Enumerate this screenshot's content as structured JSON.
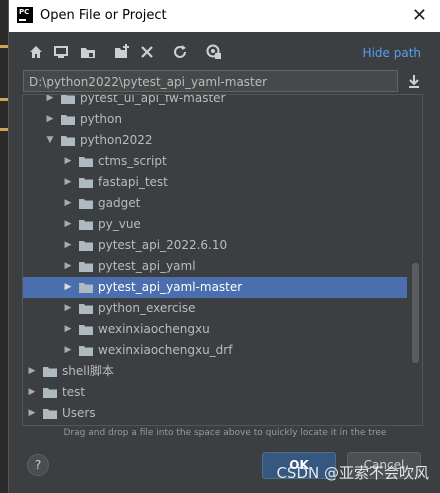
{
  "window": {
    "title": "Open File or Project",
    "close_glyph": "✕"
  },
  "toolbar": {
    "buttons": [
      "home-icon",
      "desktop-icon",
      "project-icon",
      "new-folder-icon",
      "delete-icon",
      "refresh-icon",
      "show-hidden-icon"
    ],
    "hide_path_label": "Hide path"
  },
  "path": {
    "value": "D:\\python2022\\pytest_api_yaml-master"
  },
  "tree": {
    "rows": [
      {
        "label": "pytest_ui_api_fw-master",
        "expanded": false
      },
      {
        "label": "python",
        "expanded": false
      },
      {
        "label": "python2022",
        "expanded": true
      },
      {
        "label": "ctms_script",
        "expanded": false
      },
      {
        "label": "fastapi_test",
        "expanded": false
      },
      {
        "label": "gadget",
        "expanded": false
      },
      {
        "label": "py_vue",
        "expanded": false
      },
      {
        "label": "pytest_api_2022.6.10",
        "expanded": false
      },
      {
        "label": "pytest_api_yaml",
        "expanded": false
      },
      {
        "label": "pytest_api_yaml-master",
        "expanded": false,
        "selected": true
      },
      {
        "label": "python_exercise",
        "expanded": false
      },
      {
        "label": "wexinxiaochengxu",
        "expanded": false
      },
      {
        "label": "wexinxiaochengxu_drf",
        "expanded": false
      },
      {
        "label": "shell脚本",
        "expanded": false
      },
      {
        "label": "test",
        "expanded": false
      },
      {
        "label": "Users",
        "expanded": false
      }
    ]
  },
  "hint": "Drag and drop a file into the space above to quickly locate it in the tree",
  "buttons": {
    "help": "?",
    "ok": "OK",
    "cancel": "Cancel"
  },
  "watermark": "CSDN @亚索不会吹风",
  "colors": {
    "selection": "#4b6eaf",
    "link": "#589df6",
    "ok": "#365880"
  }
}
